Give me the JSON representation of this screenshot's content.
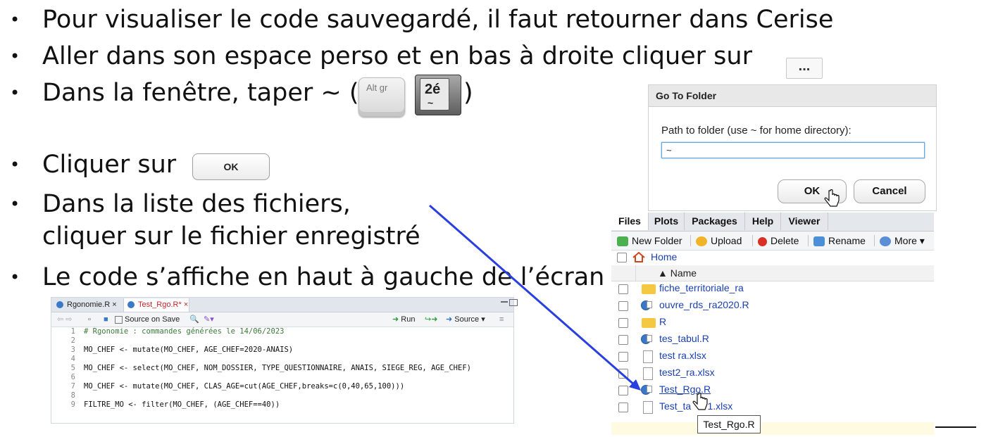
{
  "slide": {
    "bullets": [
      "Pour visualiser le code sauvegardé, il faut retourner dans Cerise",
      "Aller dans son espace perso et en bas à droite cliquer sur",
      "Dans la fenêtre, taper ~ (",
      "Cliquer sur",
      "Dans la liste des fichiers,",
      "cliquer sur le fichier enregistré",
      "Le code s’affiche en haut à gauche de l’écran"
    ],
    "bullet_symbol": "•",
    "close_paren": ")",
    "dots_button_label": "...",
    "key_altgr_label": "Alt gr",
    "key_2e_label": "2é",
    "key_2e_tilde": "~",
    "ok_button_label": "OK"
  },
  "dialog": {
    "title": "Go To Folder",
    "label": "Path to folder (use ~ for home directory):",
    "input_value": "~",
    "ok_label": "OK",
    "cancel_label": "Cancel"
  },
  "files_pane": {
    "tabs": [
      "Files",
      "Plots",
      "Packages",
      "Help",
      "Viewer"
    ],
    "toolbar": {
      "new_folder": "New Folder",
      "upload": "Upload",
      "delete": "Delete",
      "rename": "Rename",
      "more": "More"
    },
    "breadcrumb_home": "Home",
    "name_header": "▲ Name",
    "files": [
      {
        "name": "fiche_territoriale_ra",
        "type": "folder"
      },
      {
        "name": "ouvre_rds_ra2020.R",
        "type": "r"
      },
      {
        "name": "R",
        "type": "folder"
      },
      {
        "name": "tes_tabul.R",
        "type": "r"
      },
      {
        "name": "test ra.xlsx",
        "type": "doc"
      },
      {
        "name": "test2_ra.xlsx",
        "type": "doc"
      },
      {
        "name": "Test_Rgo.R",
        "type": "r"
      },
      {
        "name": "Test_ta      1.xlsx",
        "type": "doc"
      }
    ],
    "tooltip": "Test_Rgo.R"
  },
  "editor": {
    "tabs": [
      "Rgonomie.R",
      "Test_Rgo.R*"
    ],
    "toolbar": {
      "source_on_save": "Source on Save",
      "run": "Run",
      "source": "Source"
    },
    "lines": [
      {
        "n": "1",
        "code": "# Rgonomie : commandes générées le 14/06/2023"
      },
      {
        "n": "2",
        "code": ""
      },
      {
        "n": "3",
        "code": "MO_CHEF <- mutate(MO_CHEF, AGE_CHEF=2020-ANAIS)"
      },
      {
        "n": "4",
        "code": ""
      },
      {
        "n": "5",
        "code": "MO_CHEF <- select(MO_CHEF, NOM_DOSSIER, TYPE_QUESTIONNAIRE, ANAIS, SIEGE_REG, AGE_CHEF)"
      },
      {
        "n": "6",
        "code": ""
      },
      {
        "n": "7",
        "code": "MO_CHEF <- mutate(MO_CHEF, CLAS_AGE=cut(AGE_CHEF,breaks=c(0,40,65,100)))"
      },
      {
        "n": "8",
        "code": ""
      },
      {
        "n": "9",
        "code": "FILTRE_MO <- filter(MO_CHEF, (AGE_CHEF==40))"
      }
    ]
  },
  "colors": {
    "link_blue": "#1a3fb0",
    "arrow_blue": "#2a3fe0",
    "active_tab_red": "#c02626"
  }
}
